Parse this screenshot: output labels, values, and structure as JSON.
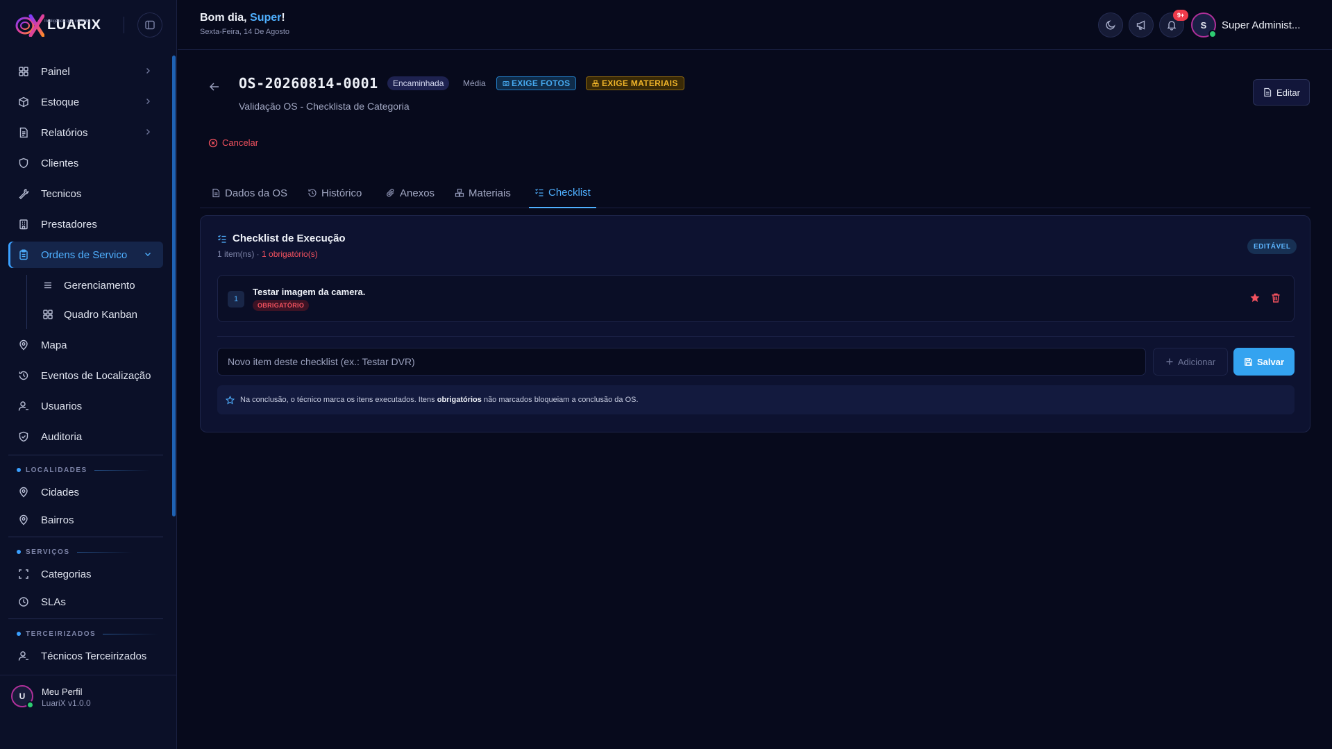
{
  "brand": {
    "name": "LUARIX",
    "tagline": "Inteligência que conecta"
  },
  "sidebar": {
    "items": [
      {
        "label": "Painel",
        "icon": "grid-icon"
      },
      {
        "label": "Estoque",
        "icon": "box-icon"
      },
      {
        "label": "Relatórios",
        "icon": "report-icon"
      },
      {
        "label": "Clientes",
        "icon": "shield-icon"
      },
      {
        "label": "Tecnicos",
        "icon": "wrench-icon"
      },
      {
        "label": "Prestadores",
        "icon": "building-icon"
      },
      {
        "label": "Ordens de Servico",
        "icon": "clipboard-icon"
      },
      {
        "label": "Gerenciamento",
        "icon": "list-icon"
      },
      {
        "label": "Quadro Kanban",
        "icon": "kanban-icon"
      },
      {
        "label": "Mapa",
        "icon": "map-pin-icon"
      },
      {
        "label": "Eventos de Localização",
        "icon": "history-icon"
      },
      {
        "label": "Usuarios",
        "icon": "user-icon"
      },
      {
        "label": "Auditoria",
        "icon": "shield-check-icon"
      },
      {
        "label": "Cidades",
        "icon": "map-pin-icon"
      },
      {
        "label": "Bairros",
        "icon": "map-pin-icon"
      },
      {
        "label": "Categorias",
        "icon": "scan-icon"
      },
      {
        "label": "SLAs",
        "icon": "clock-icon"
      },
      {
        "label": "Técnicos Terceirizados",
        "icon": "user-icon"
      }
    ],
    "sections": {
      "localidades": "LOCALIDADES",
      "servicos": "SERVIÇOS",
      "terceirizados": "TERCEIRIZADOS"
    },
    "profile": {
      "initial": "U",
      "name": "Meu Perfil",
      "version": "LuariX v1.0.0"
    }
  },
  "header": {
    "greeting_prefix": "Bom dia, ",
    "greeting_name": "Super",
    "greeting_suffix": "!",
    "date": "Sexta-Feira, 14 De Agosto",
    "notifications_badge": "9+",
    "user_initial": "S",
    "user_name": "Super Administ..."
  },
  "order": {
    "code": "OS-20260814-0001",
    "status": "Encaminhada",
    "priority": "Média",
    "photos_tag": "EXIGE FOTOS",
    "materials_tag": "EXIGE MATERIAIS",
    "subtitle": "Validação OS - Checklista de Categoria",
    "edit_label": "Editar",
    "cancel_label": "Cancelar"
  },
  "tabs": [
    {
      "label": "Dados da OS",
      "icon": "document-icon"
    },
    {
      "label": "Histórico",
      "icon": "history-icon"
    },
    {
      "label": "Anexos",
      "icon": "paperclip-icon"
    },
    {
      "label": "Materiais",
      "icon": "boxes-icon"
    },
    {
      "label": "Checklist",
      "icon": "checklist-icon"
    }
  ],
  "active_tab": "Checklist",
  "checklist": {
    "title": "Checklist de Execução",
    "meta_count": "1 item(ns) · ",
    "meta_required": "1 obrigatório(s)",
    "editable_badge": "EDITÁVEL",
    "items": [
      {
        "number": "1",
        "text": "Testar imagem da camera.",
        "tag": "OBRIGATÓRIO"
      }
    ],
    "input_placeholder": "Novo item deste checklist (ex.: Testar DVR)",
    "add_label": "Adicionar",
    "save_label": "Salvar",
    "hint_prefix": "Na conclusão, o técnico marca os itens executados. Itens ",
    "hint_bold": "obrigatórios",
    "hint_suffix": " não marcados bloqueiam a conclusão da OS."
  },
  "colors": {
    "background": "#070a1c",
    "sidebar": "#0b1028",
    "accent": "#4fb0ff",
    "danger": "#f4525f",
    "warning": "#f0b429",
    "online": "#2ecc71"
  }
}
